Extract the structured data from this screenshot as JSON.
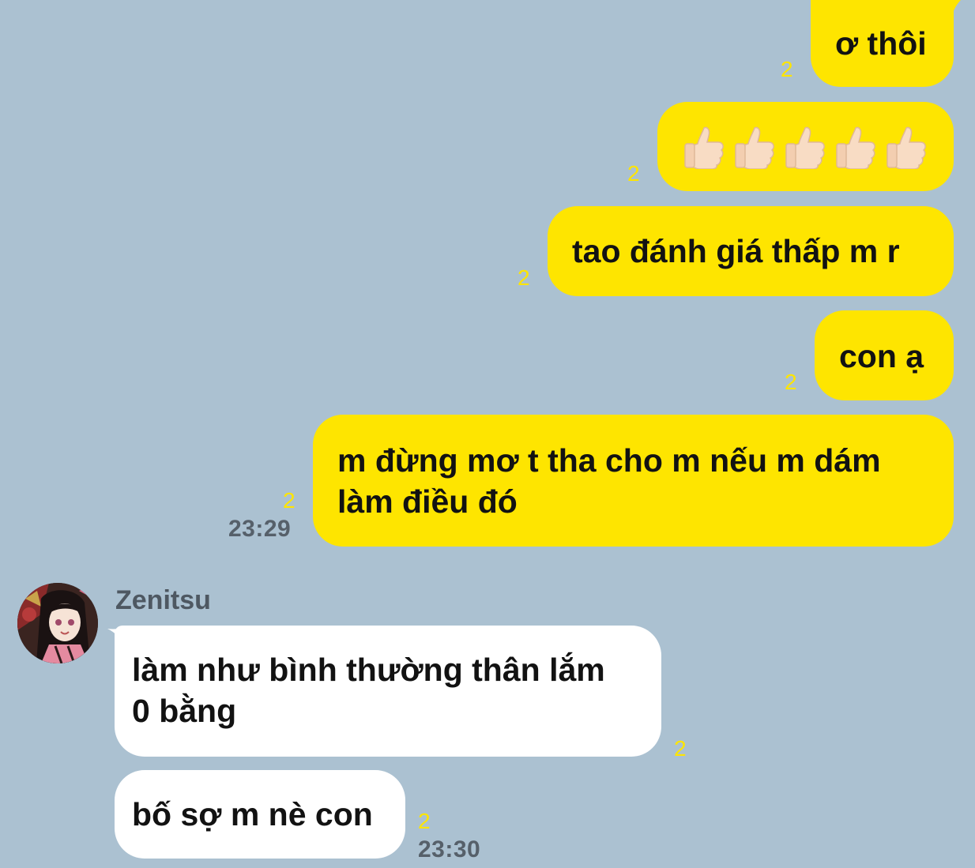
{
  "outgoing": [
    {
      "text": "ơ thôi",
      "read_count": "2"
    },
    {
      "emoji": "thumbs-up-icon",
      "emoji_count": 5,
      "read_count": "2"
    },
    {
      "text": "tao đánh giá thấp m r",
      "read_count": "2"
    },
    {
      "text": "con ạ",
      "read_count": "2"
    },
    {
      "text": "m đừng mơ t tha cho m nếu m dám\nlàm điều đó",
      "read_count": "2",
      "time": "23:29"
    }
  ],
  "incoming": {
    "sender_name": "Zenitsu",
    "messages": [
      {
        "text": "làm như bình thường thân lắm\n0 bằng",
        "read_count": "2"
      },
      {
        "text": "bố sợ m nè con",
        "read_count": "2",
        "time": "23:30"
      }
    ]
  },
  "colors": {
    "background": "#abc1d1",
    "outgoing_bubble": "#fee500",
    "incoming_bubble": "#ffffff",
    "read_count": "#fee500",
    "timestamp": "#56606a"
  }
}
